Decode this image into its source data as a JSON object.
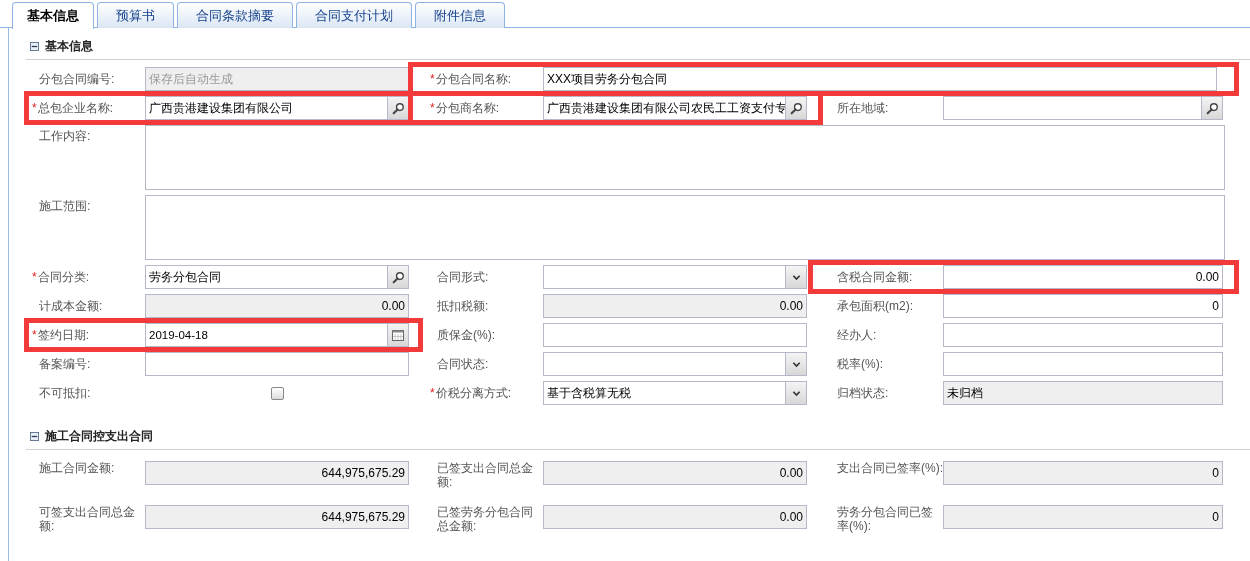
{
  "tabs": [
    {
      "label": "基本信息",
      "selected": true
    },
    {
      "label": "预算书",
      "selected": false
    },
    {
      "label": "合同条款摘要",
      "selected": false
    },
    {
      "label": "合同支付计划",
      "selected": false
    },
    {
      "label": "附件信息",
      "selected": false
    }
  ],
  "sections": [
    {
      "title": "基本信息",
      "expanded": true,
      "fields": [
        {
          "label": "分包合同编号:",
          "kind": "readonly",
          "placeholder": "保存后自动生成",
          "highlighted": false
        },
        {
          "label": "分包合同名称:",
          "required_mark": "*",
          "kind": "text",
          "value": "XXX项目劳务分包合同",
          "highlighted": true,
          "wide": true
        },
        {
          "label": "总包企业名称:",
          "required_mark": "*",
          "kind": "lookup",
          "value": "广西贵港建设集团有限公司",
          "highlighted": true
        },
        {
          "label": "分包商名称:",
          "required_mark": "*",
          "kind": "lookup",
          "value": "广西贵港建设集团有限公司农民工工资支付专",
          "highlighted": true
        },
        {
          "label": "所在地域:",
          "kind": "lookup",
          "highlighted": false
        },
        {
          "label": "工作内容:",
          "kind": "textarea",
          "highlighted": false
        },
        {
          "label": "施工范围:",
          "kind": "textarea",
          "highlighted": false
        },
        {
          "label": "合同分类:",
          "required_mark": "*",
          "kind": "lookup",
          "value": "劳务分包合同",
          "highlighted": false
        },
        {
          "label": "合同形式:",
          "kind": "select",
          "highlighted": false
        },
        {
          "label": "含税合同金额:",
          "kind": "number",
          "value": "0.00",
          "highlighted": true
        },
        {
          "label": "计成本金额:",
          "kind": "readonly_number",
          "value": "0.00",
          "highlighted": false
        },
        {
          "label": "抵扣税额:",
          "kind": "readonly_number",
          "value": "0.00",
          "highlighted": false
        },
        {
          "label": "承包面积(m2):",
          "kind": "number",
          "value": "0",
          "highlighted": false
        },
        {
          "label": "签约日期:",
          "required_mark": "*",
          "kind": "date",
          "value": "2019-04-18",
          "highlighted": true
        },
        {
          "label": "质保金(%):",
          "kind": "text",
          "highlighted": false
        },
        {
          "label": "经办人:",
          "kind": "text",
          "highlighted": false
        },
        {
          "label": "备案编号:",
          "kind": "text",
          "highlighted": false
        },
        {
          "label": "合同状态:",
          "kind": "select",
          "highlighted": false
        },
        {
          "label": "税率(%):",
          "kind": "text",
          "highlighted": false
        },
        {
          "label": "不可抵扣:",
          "kind": "checkbox",
          "checked": false,
          "highlighted": false
        },
        {
          "label": "价税分离方式:",
          "required_mark": "*",
          "kind": "select",
          "value": "基于含税算无税",
          "highlighted": false
        },
        {
          "label": "归档状态:",
          "kind": "readonly",
          "value": "未归档",
          "highlighted": false
        }
      ]
    },
    {
      "title": "施工合同控支出合同",
      "expanded": true,
      "fields": [
        {
          "label": "施工合同金额:",
          "kind": "readonly_number",
          "value": "644,975,675.29",
          "highlighted": false
        },
        {
          "label": "已签支出合同总金额:",
          "kind": "readonly_number",
          "value": "0.00",
          "highlighted": false
        },
        {
          "label": "支出合同已签率(%):",
          "kind": "readonly_number",
          "value": "0",
          "highlighted": false
        },
        {
          "label": "可签支出合同总金额:",
          "kind": "readonly_number",
          "value": "644,975,675.29",
          "highlighted": false
        },
        {
          "label": "已签劳务分包合同总金额:",
          "kind": "readonly_number",
          "value": "0.00",
          "highlighted": false
        },
        {
          "label": "劳务分包合同已签率(%):",
          "kind": "readonly_number",
          "value": "0",
          "highlighted": false
        }
      ]
    }
  ]
}
